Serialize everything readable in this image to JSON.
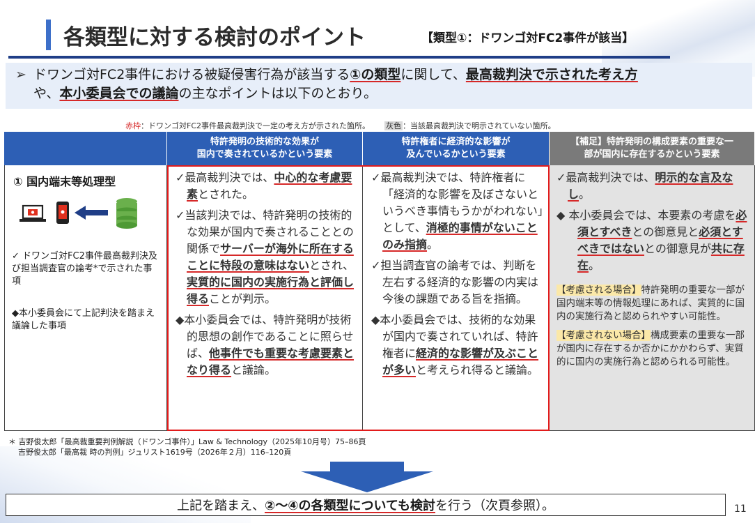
{
  "title": {
    "main": "各類型に対する検討のポイント",
    "sub": "【類型①：ドワンゴ対FC2事件が該当】"
  },
  "summary": {
    "bullet": "➢",
    "part1": "ドワンゴ対FC2事件における被疑侵害行為が該当する",
    "part2": "①の類型",
    "part3": "に関して、",
    "part4": "最高裁判決で示された考え方",
    "part5": "や、",
    "part6": "本小委員会での議論",
    "part7": "の主なポイントは以下のとおり。"
  },
  "legend": {
    "red_label": "赤枠",
    "red_text": "：ドワンゴ対FC2事件最高裁判決で一定の考え方が示された箇所。",
    "gray_label": "灰色",
    "gray_text": "：当該最高裁判決で明示されていない箇所。"
  },
  "table": {
    "headers": [
      "",
      "特許発明の技術的な効果が\n国内で奏されているかという要素",
      "特許権者に経済的な影響が\n及んでいるかという要素",
      "【補足】特許発明の構成要素の重要な一\n部が国内に存在するかという要素"
    ],
    "row_label": "① 国内端末等処理型",
    "col1_note1": "✓ ドワンゴ対FC2事件最高裁判決及び担当調査官の論考*で示された事項",
    "col1_note2": "◆本小委員会にて上記判決を踏まえ議論した事項",
    "col2": {
      "p1_a": "✓最高裁判決では、",
      "p1_b": "中心的な考慮要素",
      "p1_c": "とされた。",
      "p2_a": "✓当該判決では、特許発明の技術的な効果が国内で奏されることとの関係で",
      "p2_b": "サーバーが海外に所在することに特段の意味はない",
      "p2_c": "とされ、",
      "p2_d": "実質的に国内の実施行為と評価し得る",
      "p2_e": "ことが判示。",
      "p3_a": "◆本小委員会では、特許発明が技術的思想の創作であることに照らせば、",
      "p3_b": "他事件でも重要な考慮要素となり得る",
      "p3_c": "と議論。"
    },
    "col3": {
      "p1_a": "✓最高裁判決では、特許権者に「経済的な影響を及ぼさないというべき事情もうかがわれない」として、",
      "p1_b": "消極的事情がないことのみ指摘",
      "p1_c": "。",
      "p2": "✓担当調査官の論考では、判断を左右する経済的な影響の内実は今後の課題である旨を指摘。",
      "p3_a": "◆本小委員会では、技術的な効果が国内で奏されていれば、特許権者に",
      "p3_b": "経済的な影響が及ぶことが多い",
      "p3_c": "と考えられ得ると議論。"
    },
    "col4": {
      "p1_a": "✓最高裁判決では、",
      "p1_b": "明示的な言及なし",
      "p1_c": "。",
      "p2_a": "◆ 本小委員会では、本要素の考慮を",
      "p2_b": "必須とすべき",
      "p2_c": "との御意見と",
      "p2_d": "必須とすべきではない",
      "p2_e": "との御意見が",
      "p2_f": "共に存在",
      "p2_g": "。",
      "p3_tag": "【考慮される場合】",
      "p3_text": "特許発明の重要な一部が国内端末等の情報処理にあれば、実質的に国内の実施行為と認められやすい可能性。",
      "p4_tag": "【考慮されない場合】",
      "p4_text": "構成要素の重要な一部が国内に存在するか否かにかかわらず、実質的に国内の実施行為と認められる可能性。"
    }
  },
  "footnote": {
    "line1": "＊ 吉野俊太郎「最高裁重要判例解説（ドワンゴ事件）」Law & Technology（2025年10月号）75–86頁",
    "line2": "吉野俊太郎「最高裁 時の判例」ジュリスト1619号（2026年２月）116–120頁"
  },
  "bottom": {
    "part1": "上記を踏まえ、",
    "part2": "②〜④の各類型についても検討",
    "part3": "を行う（次頁参照）。"
  },
  "page_number": "11",
  "colors": {
    "accent": "#2d5fb5",
    "title_rule": "#1f3e87",
    "red": "#d62828",
    "gray_header": "#7a7a7a",
    "gray_cell": "#e3e3e3",
    "highlight": "#fbe8a8"
  },
  "icons": [
    "laptop-icon",
    "smartphone-icon",
    "arrow-left-icon",
    "database-icon",
    "arrow-down-icon"
  ]
}
